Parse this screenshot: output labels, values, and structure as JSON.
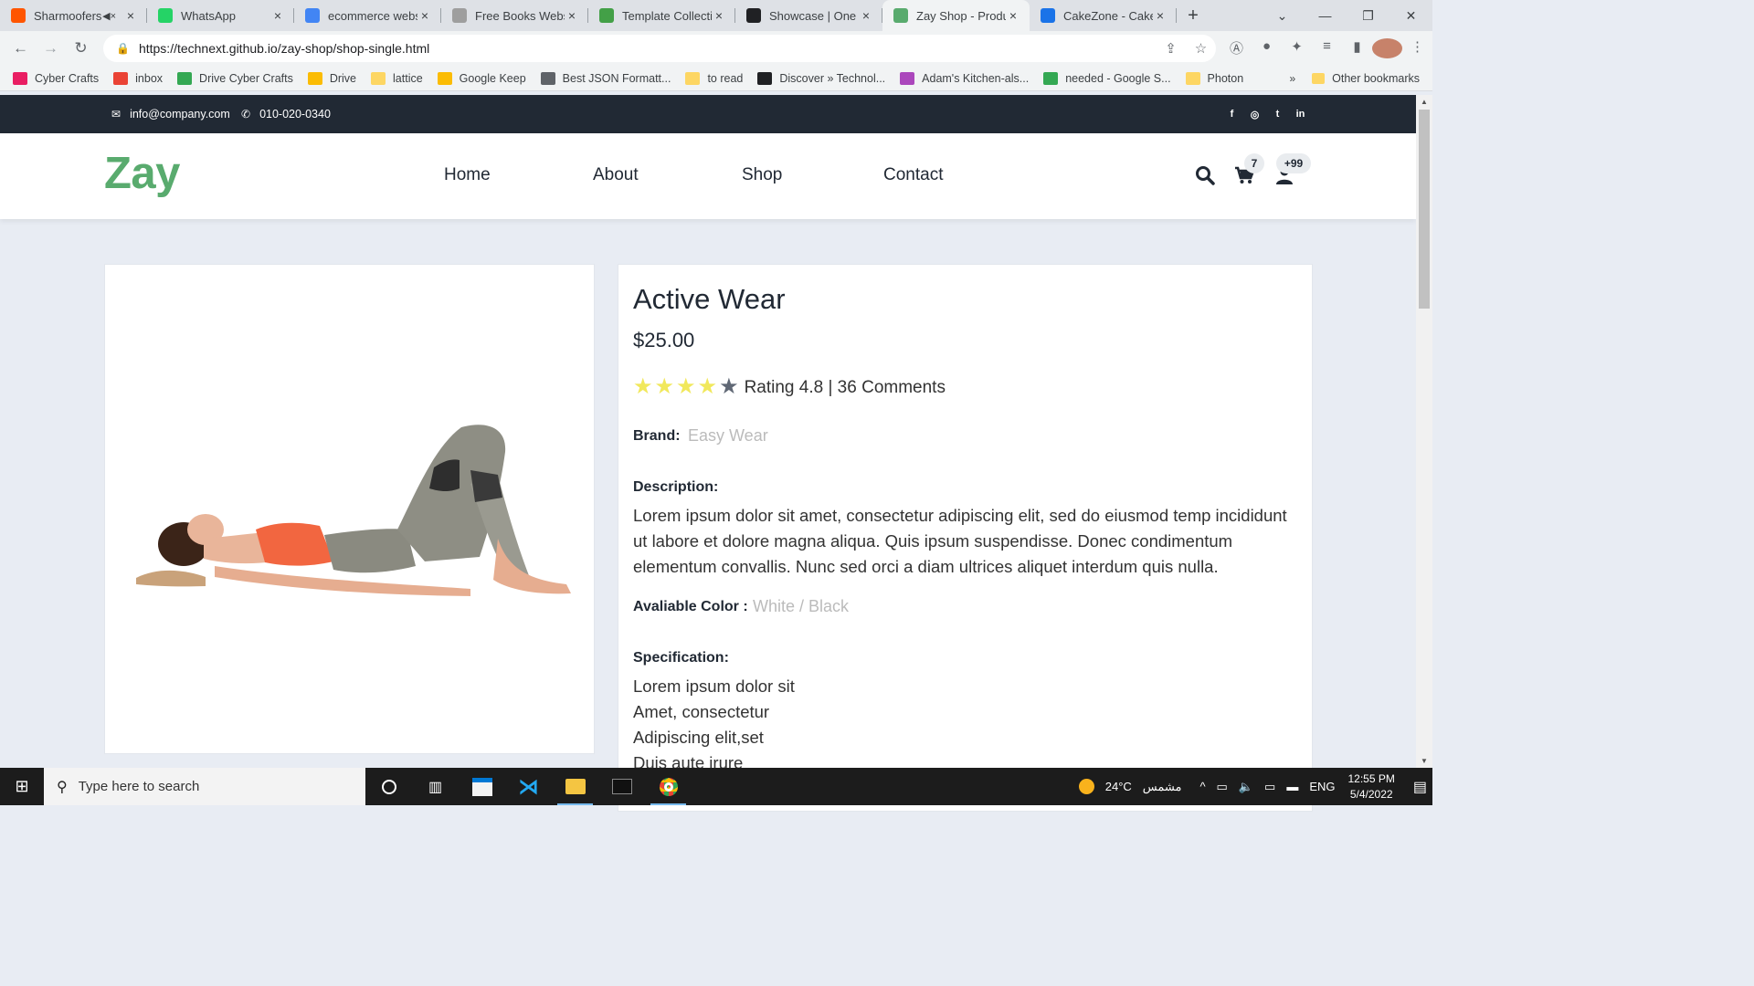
{
  "browser": {
    "tabs": [
      {
        "title": "Sharmoofers",
        "icon": "soundcloud-icon",
        "color": "#ff5500",
        "muted": true
      },
      {
        "title": "WhatsApp",
        "icon": "whatsapp-icon",
        "color": "#25d366"
      },
      {
        "title": "ecommerce webs",
        "icon": "google-icon",
        "color": "#4285f4"
      },
      {
        "title": "Free Books Webs",
        "icon": "books-icon",
        "color": "#9e9e9e"
      },
      {
        "title": "Template Collecti",
        "icon": "leaf-icon",
        "color": "#43a047"
      },
      {
        "title": "Showcase | One I",
        "icon": "globe-icon",
        "color": "#202124"
      },
      {
        "title": "Zay Shop - Produ",
        "icon": "zay-icon",
        "color": "#59ab6e",
        "active": true
      },
      {
        "title": "CakeZone - Cake",
        "icon": "dot-icon",
        "color": "#1a73e8"
      }
    ],
    "url_host": "https://technext.github.io",
    "url_path": "/zay-shop/shop-single.html",
    "bookmarks": [
      {
        "label": "Cyber Crafts",
        "color": "#e91e63"
      },
      {
        "label": "inbox",
        "color": "#ea4335"
      },
      {
        "label": "Drive Cyber Crafts",
        "color": "#34a853"
      },
      {
        "label": "Drive",
        "color": "#fbbc04"
      },
      {
        "label": "lattice",
        "color": "#fdd663"
      },
      {
        "label": "Google Keep",
        "color": "#fbbc04"
      },
      {
        "label": "Best JSON Formatt...",
        "color": "#5f6368"
      },
      {
        "label": "to read",
        "color": "#fdd663"
      },
      {
        "label": "Discover » Technol...",
        "color": "#202124"
      },
      {
        "label": "Adam's Kitchen-als...",
        "color": "#ab47bc"
      },
      {
        "label": "needed - Google S...",
        "color": "#34a853"
      },
      {
        "label": "Photon",
        "color": "#fdd663"
      }
    ],
    "bookmarks_more": "»",
    "other_bookmarks": "Other bookmarks"
  },
  "site": {
    "email": "info@company.com",
    "phone": "010-020-0340",
    "social": [
      "f",
      "◎",
      "t",
      "in"
    ],
    "logo": "Zay",
    "menu": [
      "Home",
      "About",
      "Shop",
      "Contact"
    ],
    "cart_count": "7",
    "user_count": "+99",
    "accent": "#59ab6e"
  },
  "product": {
    "title": "Active Wear",
    "price": "$25.00",
    "stars_filled": 4,
    "stars_total": 5,
    "rating_text": "Rating 4.8 | 36 Comments",
    "brand_label": "Brand:",
    "brand_value": "Easy Wear",
    "description_label": "Description:",
    "description": "Lorem ipsum dolor sit amet, consectetur adipiscing elit, sed do eiusmod temp incididunt ut labore et dolore magna aliqua. Quis ipsum suspendisse. Donec condimentum elementum convallis. Nunc sed orci a diam ultrices aliquet interdum quis nulla.",
    "color_label": "Avaliable Color :",
    "color_value": "White / Black",
    "spec_label": "Specification:",
    "specs": [
      "Lorem ipsum dolor sit",
      "Amet, consectetur",
      "Adipiscing elit,set",
      "Duis aute irure"
    ]
  },
  "taskbar": {
    "search_placeholder": "Type here to search",
    "temperature": "24°C",
    "weather": "مشمس",
    "language": "ENG",
    "time": "12:55 PM",
    "date": "5/4/2022"
  }
}
